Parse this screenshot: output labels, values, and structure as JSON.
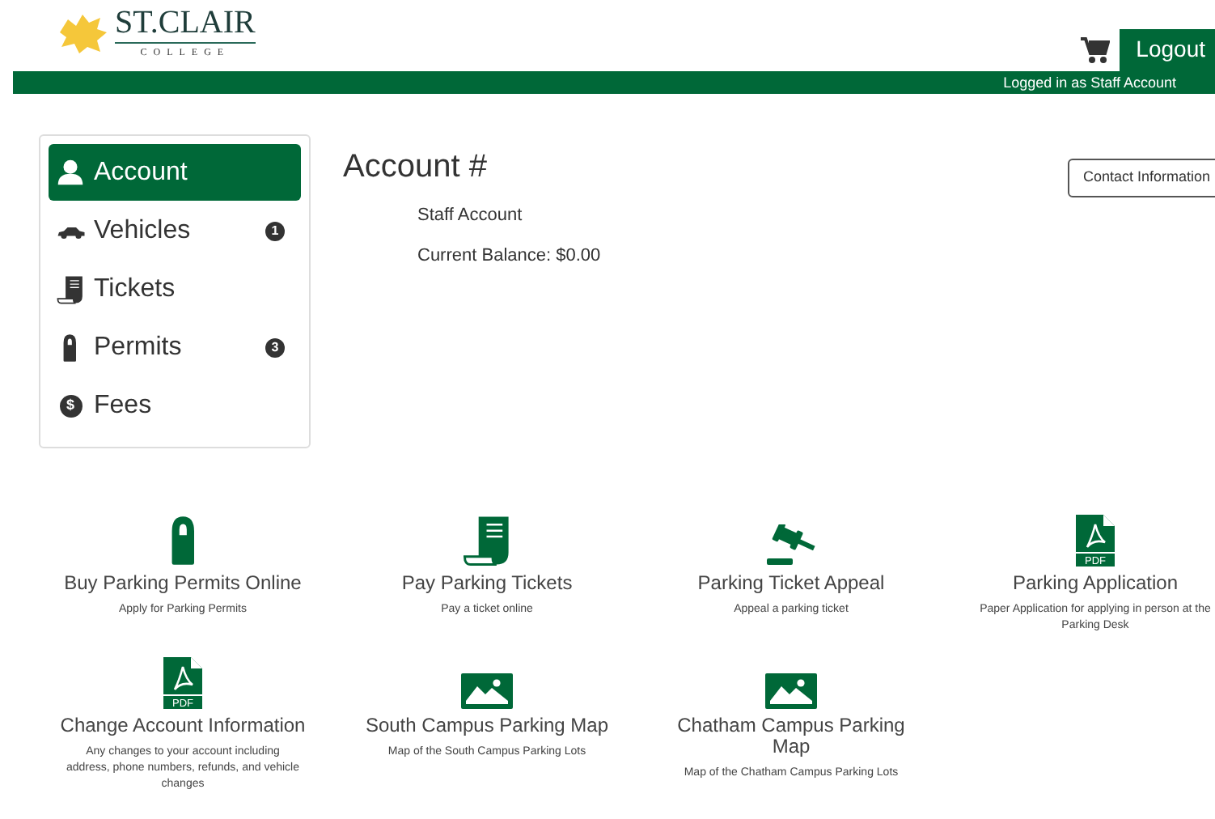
{
  "header": {
    "logo": {
      "name": "ST.CLAIR",
      "subtitle": "COLLEGE"
    },
    "logout_button": "Logout",
    "status": "Logged in as Staff Account"
  },
  "sidebar": {
    "items": [
      {
        "label": "Account",
        "kind": "person",
        "selected": true
      },
      {
        "label": "Vehicles",
        "kind": "car",
        "selected": false,
        "badge": "1"
      },
      {
        "label": "Tickets",
        "kind": "receipt",
        "selected": false
      },
      {
        "label": "Permits",
        "kind": "hanger",
        "selected": false,
        "badge": "3"
      },
      {
        "label": "Fees",
        "kind": "dollar",
        "icon_text": "$",
        "selected": false
      }
    ]
  },
  "account": {
    "title": "Account #",
    "name": "Staff Account",
    "balance": "Current Balance: $0.00",
    "contact_button": "Contact Information"
  },
  "tiles": [
    {
      "kind": "hanger",
      "title": "Buy Parking Permits Online",
      "description": "Apply for Parking Permits"
    },
    {
      "kind": "receipt",
      "title": "Pay Parking Tickets",
      "description": "Pay a ticket online"
    },
    {
      "kind": "gavel",
      "title": "Parking Ticket Appeal",
      "description": "Appeal a parking ticket"
    },
    {
      "kind": "pdf",
      "icon_text": "PDF",
      "title": "Parking Application",
      "description": "Paper Application for applying in person at the Parking Desk"
    },
    {
      "kind": "pdf",
      "icon_text": "PDF",
      "title": "Change Account Information",
      "description": "Any changes to your account including address, phone numbers, refunds, and vehicle changes"
    },
    {
      "kind": "image",
      "title": "South Campus Parking Map",
      "description": "Map of the South Campus Parking Lots"
    },
    {
      "kind": "image",
      "title": "Chatham Campus Parking Map",
      "description": "Map of the Chatham Campus Parking Lots"
    }
  ]
}
